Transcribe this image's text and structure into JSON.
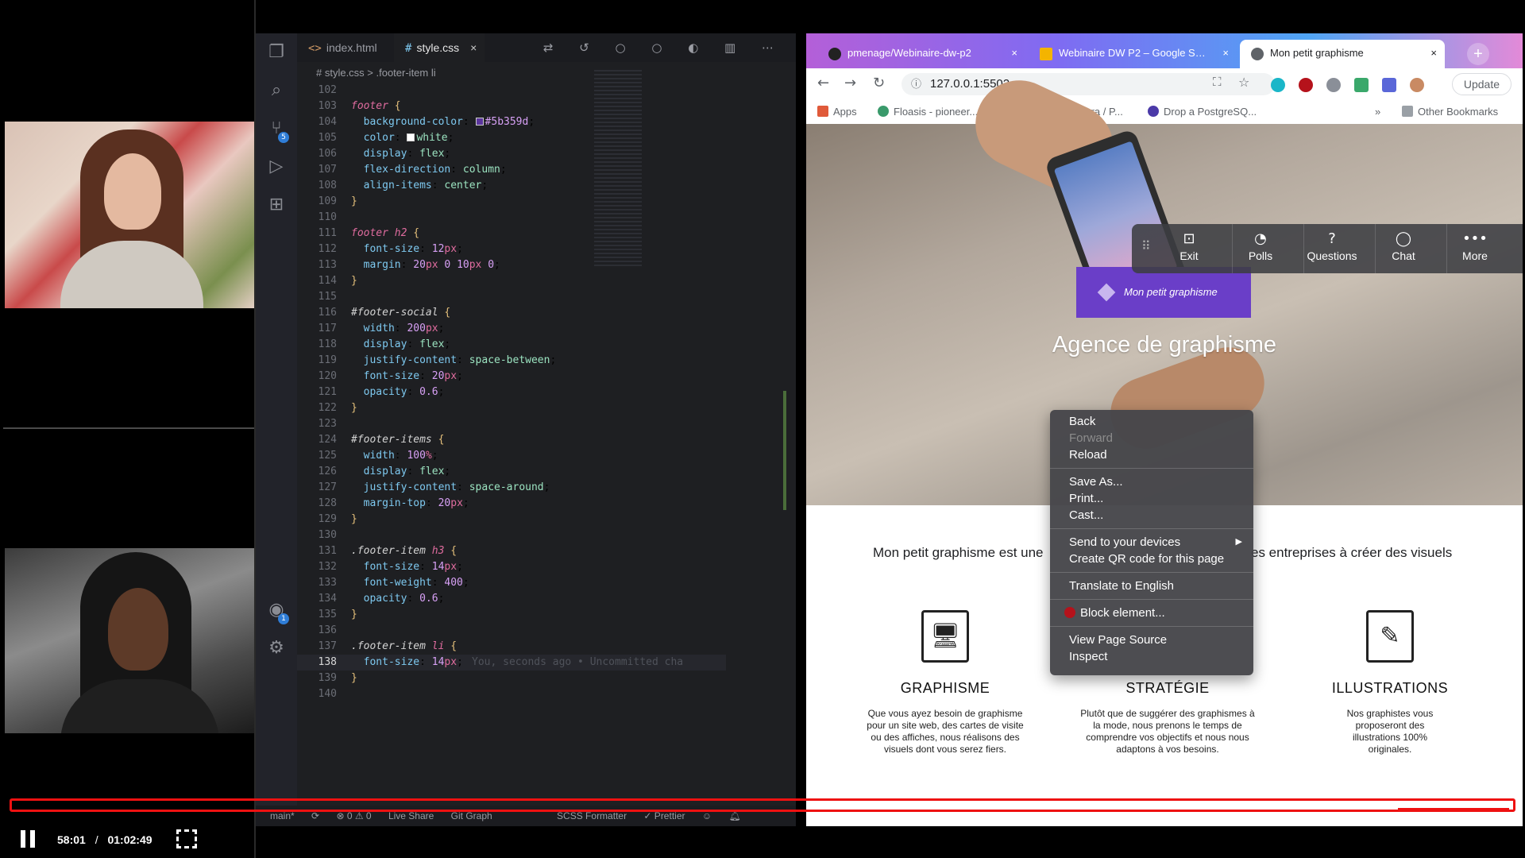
{
  "vscode": {
    "tabs": [
      {
        "icon": "<>",
        "label": "index.html"
      },
      {
        "icon": "#",
        "label": "style.css",
        "close": "×"
      }
    ],
    "toolbar_glyphs": "⇄ ↺ ○ ○ ◐ ▥ ⋯",
    "breadcrumb": "# style.css > .footer-item li",
    "source_control_badge": "5",
    "accounts_badge": "1",
    "ghost_text": "You, seconds ago • Uncommitted cha",
    "status": {
      "branch": "main*",
      "errors": "⊗ 0 ⚠ 0",
      "live_share": "Live Share",
      "git_graph": "Git Graph",
      "scss_formatter": "SCSS Formatter",
      "prettier": "✓ Prettier"
    },
    "lines": [
      {
        "n": "102",
        "t": ""
      },
      {
        "n": "103",
        "t": "footer {"
      },
      {
        "n": "104",
        "t": "  background-color: #5b359d;"
      },
      {
        "n": "105",
        "t": "  color: white;"
      },
      {
        "n": "106",
        "t": "  display: flex;"
      },
      {
        "n": "107",
        "t": "  flex-direction: column;"
      },
      {
        "n": "108",
        "t": "  align-items: center;"
      },
      {
        "n": "109",
        "t": "}"
      },
      {
        "n": "110",
        "t": ""
      },
      {
        "n": "111",
        "t": "footer h2 {"
      },
      {
        "n": "112",
        "t": "  font-size: 12px;"
      },
      {
        "n": "113",
        "t": "  margin: 20px 0 10px 0;"
      },
      {
        "n": "114",
        "t": "}"
      },
      {
        "n": "115",
        "t": ""
      },
      {
        "n": "116",
        "t": "#footer-social {"
      },
      {
        "n": "117",
        "t": "  width: 200px;"
      },
      {
        "n": "118",
        "t": "  display: flex;"
      },
      {
        "n": "119",
        "t": "  justify-content: space-between;"
      },
      {
        "n": "120",
        "t": "  font-size: 20px;"
      },
      {
        "n": "121",
        "t": "  opacity: 0.6;"
      },
      {
        "n": "122",
        "t": "}"
      },
      {
        "n": "123",
        "t": ""
      },
      {
        "n": "124",
        "t": "#footer-items {"
      },
      {
        "n": "125",
        "t": "  width: 100%;"
      },
      {
        "n": "126",
        "t": "  display: flex;"
      },
      {
        "n": "127",
        "t": "  justify-content: space-around;"
      },
      {
        "n": "128",
        "t": "  margin-top: 20px;"
      },
      {
        "n": "129",
        "t": "}"
      },
      {
        "n": "130",
        "t": ""
      },
      {
        "n": "131",
        "t": ".footer-item h3 {"
      },
      {
        "n": "132",
        "t": "  font-size: 14px;"
      },
      {
        "n": "133",
        "t": "  font-weight: 400;"
      },
      {
        "n": "134",
        "t": "  opacity: 0.6;"
      },
      {
        "n": "135",
        "t": "}"
      },
      {
        "n": "136",
        "t": ""
      },
      {
        "n": "137",
        "t": ".footer-item li {"
      },
      {
        "n": "138",
        "t": "  font-size: 14px;"
      },
      {
        "n": "139",
        "t": "}"
      },
      {
        "n": "140",
        "t": ""
      }
    ]
  },
  "browser": {
    "tabs": [
      "pmenage/Webinaire-dw-p2",
      "Webinaire DW P2 – Google S…",
      "Mon petit graphisme"
    ],
    "tab_close": "×",
    "new_tab": "+",
    "url": "127.0.0.1:5502",
    "update_label": "Update",
    "bookmarks": [
      "Apps",
      "Floasis - pioneer...",
      "Karta pasażera / P...",
      "Drop a PostgreSQ...",
      "»",
      "Other Bookmarks"
    ],
    "page": {
      "brand": "Mon petit graphisme",
      "title": "Agence de graphisme",
      "intro_left": "Mon petit graphisme est une",
      "intro_right": "es entreprises à créer des visuels",
      "services": [
        {
          "title": "GRAPHISME",
          "icon": "🖥",
          "text": "Que vous ayez besoin de graphisme pour un site web, des cartes de visite ou des affiches, nous réalisons des visuels dont vous serez fiers."
        },
        {
          "title": "STRATÉGIE",
          "icon": "",
          "text": "Plutôt que de suggérer des graphismes à la mode, nous prenons le temps de comprendre vos objectifs et nous nous adaptons à vos besoins."
        },
        {
          "title": "ILLUSTRATIONS",
          "icon": "✎",
          "text": "Nos graphistes vous proposeront des illustrations 100% originales."
        }
      ]
    },
    "meeting_toolbar": {
      "grip": "⠿",
      "items": [
        {
          "glyph": "⊡",
          "label": "Exit"
        },
        {
          "glyph": "◔",
          "label": "Polls"
        },
        {
          "glyph": "?",
          "label": "Questions"
        },
        {
          "glyph": "◯",
          "label": "Chat"
        },
        {
          "glyph": "•••",
          "label": "More"
        }
      ]
    },
    "context_menu": {
      "back": "Back",
      "forward": "Forward",
      "reload": "Reload",
      "save_as": "Save As...",
      "print": "Print...",
      "cast": "Cast...",
      "send": "Send to your devices",
      "send_arrow": "▶",
      "qr": "Create QR code for this page",
      "translate": "Translate to English",
      "block": "Block element...",
      "view_source": "View Page Source",
      "inspect": "Inspect"
    }
  },
  "player": {
    "current_time": "58:01",
    "separator": "/",
    "duration": "01:02:49"
  }
}
